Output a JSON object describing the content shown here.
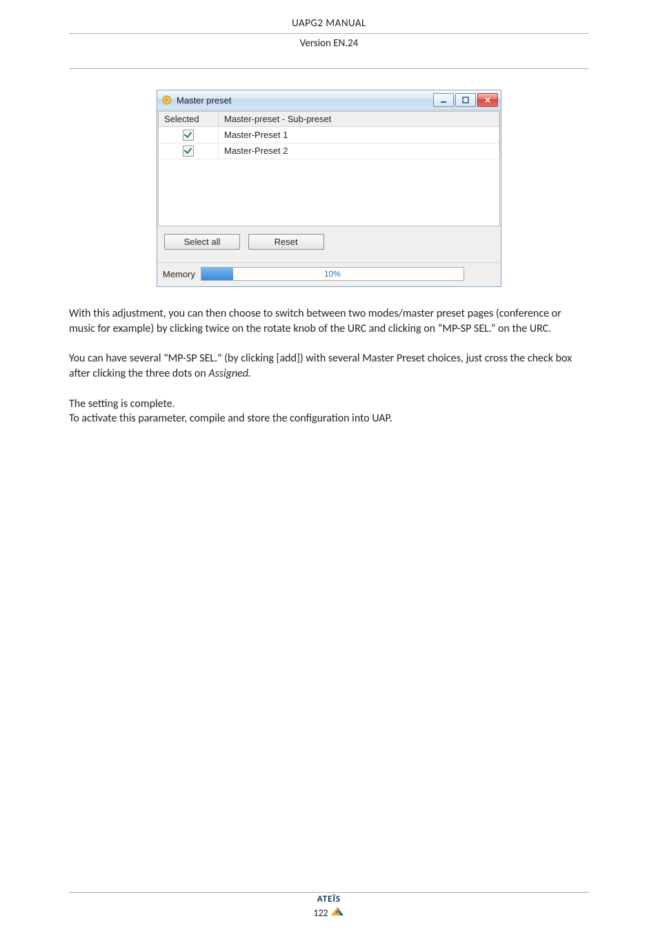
{
  "header": {
    "line1": "UAPG2  MANUAL",
    "line2": "Version EN.24"
  },
  "dialog": {
    "title": "Master preset",
    "columns": {
      "selected": "Selected",
      "name": "Master-preset - Sub-preset"
    },
    "rows": [
      {
        "selected": true,
        "label": "Master-Preset 1"
      },
      {
        "selected": true,
        "label": "Master-Preset 2"
      }
    ],
    "buttons": {
      "select_all": "Select all",
      "reset": "Reset"
    },
    "memory": {
      "label": "Memory",
      "text": "10%"
    }
  },
  "body": {
    "p1": "With this adjustment, you can then choose to switch between two modes/master preset pages (conference or music for example) by clicking twice on the rotate knob of the URC and clicking on “MP-SP SEL.” on the URC.",
    "p2a": "You can have several \"MP-SP SEL.\" (by clicking [add]) with several Master Preset choices, just cross the check box after clicking the three dots on ",
    "p2b": "Assigned.",
    "p3": "The setting is complete.",
    "p4": "To activate this parameter, compile and store the configuration into UAP."
  },
  "footer": {
    "brand": "ATEÏS",
    "page": "122"
  }
}
